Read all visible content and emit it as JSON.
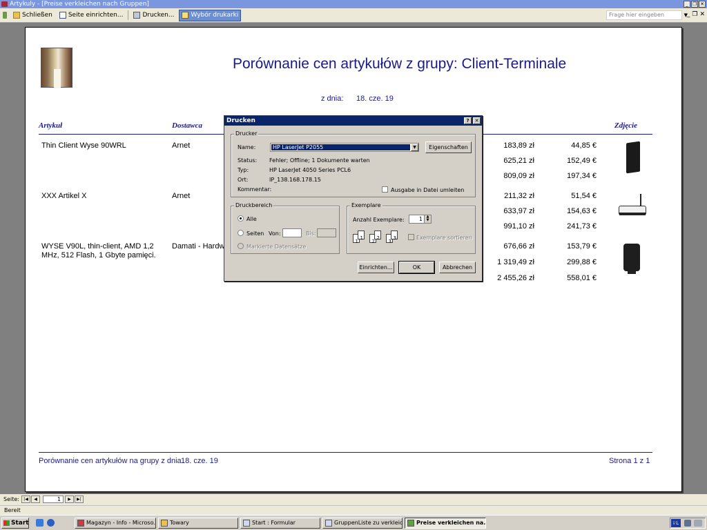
{
  "window": {
    "title": "Artykuly - [Preise verkleichen nach Gruppen]"
  },
  "toolbar": {
    "close_label": "Schließen",
    "page_setup_label": "Seite einrichten...",
    "print_label": "Drucken...",
    "choose_printer_label": "Wybór drukarki",
    "help_placeholder": "Frage hier eingeben"
  },
  "report": {
    "title": "Porównanie cen artykułów z grupy: Client-Terminale",
    "date_label": "z dnia:",
    "date_value": "18. cze. 19",
    "columns": {
      "article": "Artykuł",
      "supplier": "Dostawca",
      "photo": "Zdjęcie"
    },
    "rows": [
      {
        "article": "Thin Client Wyse 90WRL",
        "supplier": "Arnet",
        "prices_pln": [
          "183,89 zł",
          "625,21 zł",
          "809,09 zł"
        ],
        "prices_eur": [
          "44,85 €",
          "152,49 €",
          "197,34 €"
        ],
        "photo_icon": "thin-client-tower-icon"
      },
      {
        "article": "XXX  Artikel X",
        "supplier": "Arnet",
        "prices_pln": [
          "211,32 zł",
          "633,97 zł",
          "991,10 zł"
        ],
        "prices_eur": [
          "51,54 €",
          "154,63 €",
          "241,73 €"
        ],
        "photo_icon": "thin-client-router-icon"
      },
      {
        "article": "WYSE V90L, thin-client, AMD 1,2 MHz, 512 Flash, 1 Gbyte pamięci.",
        "supplier": "Damati - Hardwa",
        "prices_pln": [
          "676,66 zł",
          "1 319,49 zł",
          "2 455,26 zł"
        ],
        "prices_eur": [
          "153,79 €",
          "299,88 €",
          "558,01 €"
        ],
        "photo_icon": "thin-client-stand-icon"
      }
    ],
    "footer_left": "Porównanie cen artykułów na grupy z dnia",
    "footer_date": "18. cze. 19",
    "footer_page": "Strona 1 z  1"
  },
  "print_dialog": {
    "title": "Drucken",
    "help_btn": "?",
    "close_btn": "✕",
    "printer_group": "Drucker",
    "name_label": "Name:",
    "printer_name": "HP LaserJet P2055",
    "properties_btn": "Eigenschaften",
    "status_label": "Status:",
    "status_value": "Fehler; Offline; 1 Dokumente warten",
    "type_label": "Typ:",
    "type_value": "HP LaserJet 4050 Series PCL6",
    "location_label": "Ort:",
    "location_value": "IP_138.168.178.15",
    "comment_label": "Kommentar:",
    "print_to_file_label": "Ausgabe in Datei umleiten",
    "range_group": "Druckbereich",
    "all_label": "Alle",
    "pages_label": "Seiten",
    "from_label": "Von:",
    "to_label": "Bis:",
    "selected_records_label": "Markierte Datensätze",
    "copies_group": "Exemplare",
    "copies_count_label": "Anzahl Exemplare:",
    "copies_value": "1",
    "collate_label": "Exemplare sortieren",
    "setup_btn": "Einrichten...",
    "ok_btn": "OK",
    "cancel_btn": "Abbrechen"
  },
  "navigator": {
    "label": "Seite:",
    "current": "1"
  },
  "status": {
    "text": "Bereit"
  },
  "taskbar": {
    "start_label": "Start",
    "tasks": [
      "Magazyn - Info - Microso...",
      "Towary",
      "Start : Formular",
      "GruppenListe zu verkleic...",
      "Preise verkleichen na..."
    ],
    "lang": "PL"
  }
}
